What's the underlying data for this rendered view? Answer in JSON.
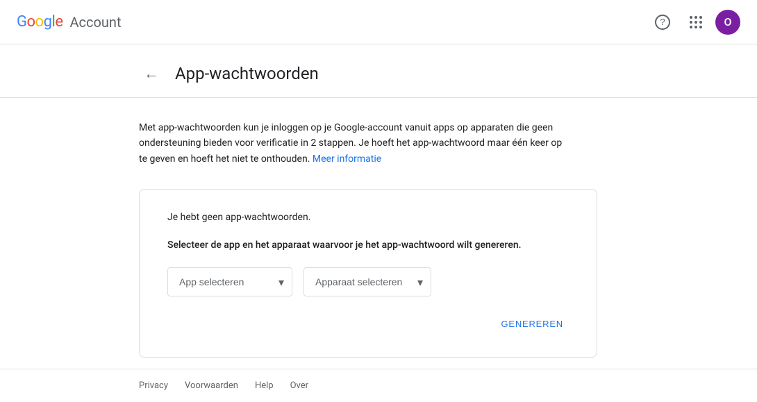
{
  "header": {
    "logo": {
      "google": "Google",
      "account": "Account"
    },
    "help_label": "?",
    "avatar_label": "O"
  },
  "page": {
    "back_label": "←",
    "title": "App-wachtwoorden",
    "description_part1": "Met app-wachtwoorden kun je inloggen op je Google-account vanuit apps op apparaten die geen ondersteuning bieden voor verificatie in 2 stappen. Je hoeft het app-wachtwoord maar één keer op te geven en hoeft het niet te onthouden.",
    "description_link": "Meer informatie",
    "card": {
      "no_passwords_text": "Je hebt geen app-wachtwoorden.",
      "select_instruction": "Selecteer de app en het apparaat waarvoor je het app-wachtwoord wilt genereren.",
      "app_select_placeholder": "App selecteren",
      "device_select_placeholder": "Apparaat selecteren",
      "generate_button": "GENEREREN"
    }
  },
  "footer": {
    "links": [
      {
        "label": "Privacy"
      },
      {
        "label": "Voorwaarden"
      },
      {
        "label": "Help"
      },
      {
        "label": "Over"
      }
    ]
  }
}
